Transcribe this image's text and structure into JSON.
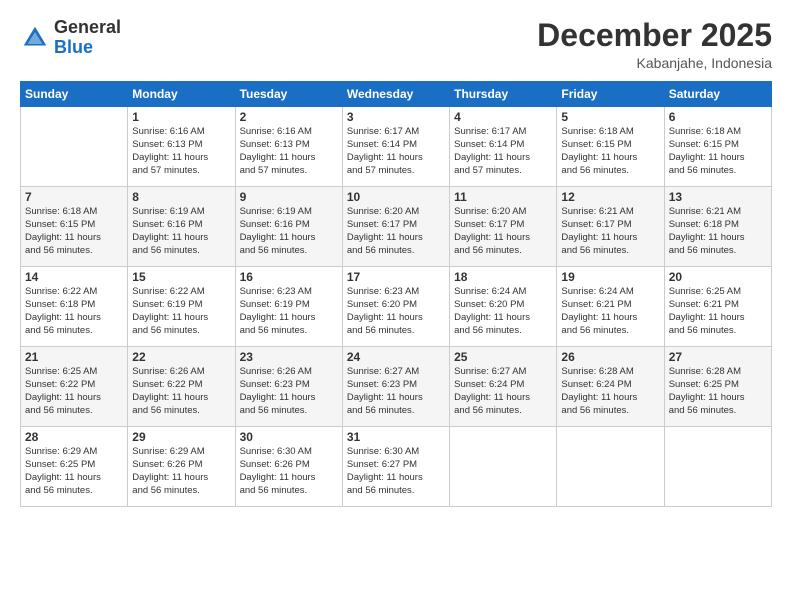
{
  "header": {
    "logo_line1": "General",
    "logo_line2": "Blue",
    "month": "December 2025",
    "location": "Kabanjahe, Indonesia"
  },
  "weekdays": [
    "Sunday",
    "Monday",
    "Tuesday",
    "Wednesday",
    "Thursday",
    "Friday",
    "Saturday"
  ],
  "weeks": [
    [
      {
        "day": "",
        "info": ""
      },
      {
        "day": "1",
        "info": "Sunrise: 6:16 AM\nSunset: 6:13 PM\nDaylight: 11 hours\nand 57 minutes."
      },
      {
        "day": "2",
        "info": "Sunrise: 6:16 AM\nSunset: 6:13 PM\nDaylight: 11 hours\nand 57 minutes."
      },
      {
        "day": "3",
        "info": "Sunrise: 6:17 AM\nSunset: 6:14 PM\nDaylight: 11 hours\nand 57 minutes."
      },
      {
        "day": "4",
        "info": "Sunrise: 6:17 AM\nSunset: 6:14 PM\nDaylight: 11 hours\nand 57 minutes."
      },
      {
        "day": "5",
        "info": "Sunrise: 6:18 AM\nSunset: 6:15 PM\nDaylight: 11 hours\nand 56 minutes."
      },
      {
        "day": "6",
        "info": "Sunrise: 6:18 AM\nSunset: 6:15 PM\nDaylight: 11 hours\nand 56 minutes."
      }
    ],
    [
      {
        "day": "7",
        "info": "Sunrise: 6:18 AM\nSunset: 6:15 PM\nDaylight: 11 hours\nand 56 minutes."
      },
      {
        "day": "8",
        "info": "Sunrise: 6:19 AM\nSunset: 6:16 PM\nDaylight: 11 hours\nand 56 minutes."
      },
      {
        "day": "9",
        "info": "Sunrise: 6:19 AM\nSunset: 6:16 PM\nDaylight: 11 hours\nand 56 minutes."
      },
      {
        "day": "10",
        "info": "Sunrise: 6:20 AM\nSunset: 6:17 PM\nDaylight: 11 hours\nand 56 minutes."
      },
      {
        "day": "11",
        "info": "Sunrise: 6:20 AM\nSunset: 6:17 PM\nDaylight: 11 hours\nand 56 minutes."
      },
      {
        "day": "12",
        "info": "Sunrise: 6:21 AM\nSunset: 6:17 PM\nDaylight: 11 hours\nand 56 minutes."
      },
      {
        "day": "13",
        "info": "Sunrise: 6:21 AM\nSunset: 6:18 PM\nDaylight: 11 hours\nand 56 minutes."
      }
    ],
    [
      {
        "day": "14",
        "info": "Sunrise: 6:22 AM\nSunset: 6:18 PM\nDaylight: 11 hours\nand 56 minutes."
      },
      {
        "day": "15",
        "info": "Sunrise: 6:22 AM\nSunset: 6:19 PM\nDaylight: 11 hours\nand 56 minutes."
      },
      {
        "day": "16",
        "info": "Sunrise: 6:23 AM\nSunset: 6:19 PM\nDaylight: 11 hours\nand 56 minutes."
      },
      {
        "day": "17",
        "info": "Sunrise: 6:23 AM\nSunset: 6:20 PM\nDaylight: 11 hours\nand 56 minutes."
      },
      {
        "day": "18",
        "info": "Sunrise: 6:24 AM\nSunset: 6:20 PM\nDaylight: 11 hours\nand 56 minutes."
      },
      {
        "day": "19",
        "info": "Sunrise: 6:24 AM\nSunset: 6:21 PM\nDaylight: 11 hours\nand 56 minutes."
      },
      {
        "day": "20",
        "info": "Sunrise: 6:25 AM\nSunset: 6:21 PM\nDaylight: 11 hours\nand 56 minutes."
      }
    ],
    [
      {
        "day": "21",
        "info": "Sunrise: 6:25 AM\nSunset: 6:22 PM\nDaylight: 11 hours\nand 56 minutes."
      },
      {
        "day": "22",
        "info": "Sunrise: 6:26 AM\nSunset: 6:22 PM\nDaylight: 11 hours\nand 56 minutes."
      },
      {
        "day": "23",
        "info": "Sunrise: 6:26 AM\nSunset: 6:23 PM\nDaylight: 11 hours\nand 56 minutes."
      },
      {
        "day": "24",
        "info": "Sunrise: 6:27 AM\nSunset: 6:23 PM\nDaylight: 11 hours\nand 56 minutes."
      },
      {
        "day": "25",
        "info": "Sunrise: 6:27 AM\nSunset: 6:24 PM\nDaylight: 11 hours\nand 56 minutes."
      },
      {
        "day": "26",
        "info": "Sunrise: 6:28 AM\nSunset: 6:24 PM\nDaylight: 11 hours\nand 56 minutes."
      },
      {
        "day": "27",
        "info": "Sunrise: 6:28 AM\nSunset: 6:25 PM\nDaylight: 11 hours\nand 56 minutes."
      }
    ],
    [
      {
        "day": "28",
        "info": "Sunrise: 6:29 AM\nSunset: 6:25 PM\nDaylight: 11 hours\nand 56 minutes."
      },
      {
        "day": "29",
        "info": "Sunrise: 6:29 AM\nSunset: 6:26 PM\nDaylight: 11 hours\nand 56 minutes."
      },
      {
        "day": "30",
        "info": "Sunrise: 6:30 AM\nSunset: 6:26 PM\nDaylight: 11 hours\nand 56 minutes."
      },
      {
        "day": "31",
        "info": "Sunrise: 6:30 AM\nSunset: 6:27 PM\nDaylight: 11 hours\nand 56 minutes."
      },
      {
        "day": "",
        "info": ""
      },
      {
        "day": "",
        "info": ""
      },
      {
        "day": "",
        "info": ""
      }
    ]
  ]
}
